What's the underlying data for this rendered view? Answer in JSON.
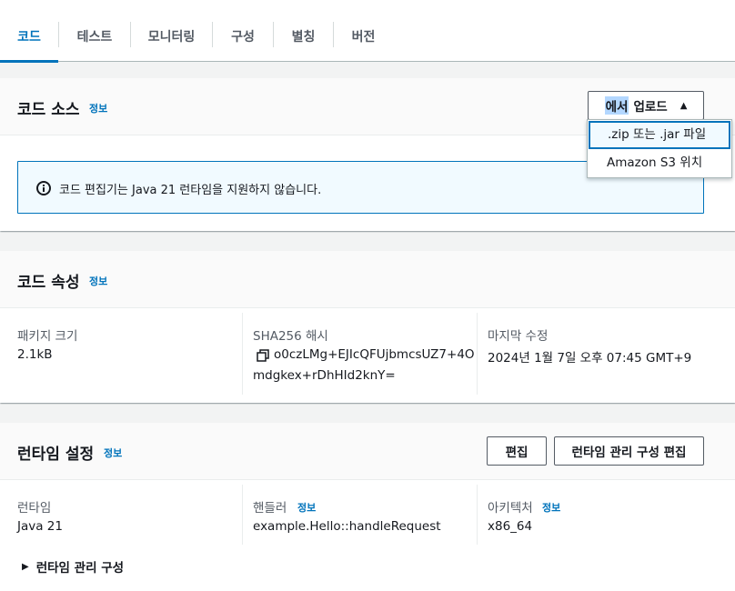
{
  "tabs": [
    {
      "label": "코드",
      "active": true
    },
    {
      "label": "테스트"
    },
    {
      "label": "모니터링"
    },
    {
      "label": "구성"
    },
    {
      "label": "별칭"
    },
    {
      "label": "버전"
    }
  ],
  "code_source": {
    "title": "코드 소스",
    "info": "정보",
    "upload_button": {
      "highlight": "에서",
      "rest": "업로드"
    },
    "dropdown": [
      ".zip 또는 .jar 파일",
      "Amazon S3 위치"
    ],
    "alert_text": "코드 편집기는 Java 21 런타임을 지원하지 않습니다."
  },
  "code_props": {
    "title": "코드 속성",
    "info": "정보",
    "package_size_label": "패키지 크기",
    "package_size": "2.1kB",
    "sha_label": "SHA256 해시",
    "sha_line1": "o0czLMg+EJIcQFUjbmcsUZ7+4O",
    "sha_line2": "mdgkex+rDhHId2knY=",
    "modified_label": "마지막 수정",
    "modified": "2024년 1월 7일 오후 07:45 GMT+9"
  },
  "runtime": {
    "title": "런타임 설정",
    "info": "정보",
    "edit_button": "편집",
    "manage_button": "런타임 관리 구성 편집",
    "runtime_label": "런타임",
    "runtime_value": "Java 21",
    "handler_label": "핸들러",
    "handler_info": "정보",
    "handler_value": "example.Hello::handleRequest",
    "arch_label": "아키텍처",
    "arch_info": "정보",
    "arch_value": "x86_64",
    "expander": "런타임 관리 구성"
  },
  "colors": {
    "accent": "#0073bb",
    "text": "#16191f",
    "muted": "#545b64"
  }
}
